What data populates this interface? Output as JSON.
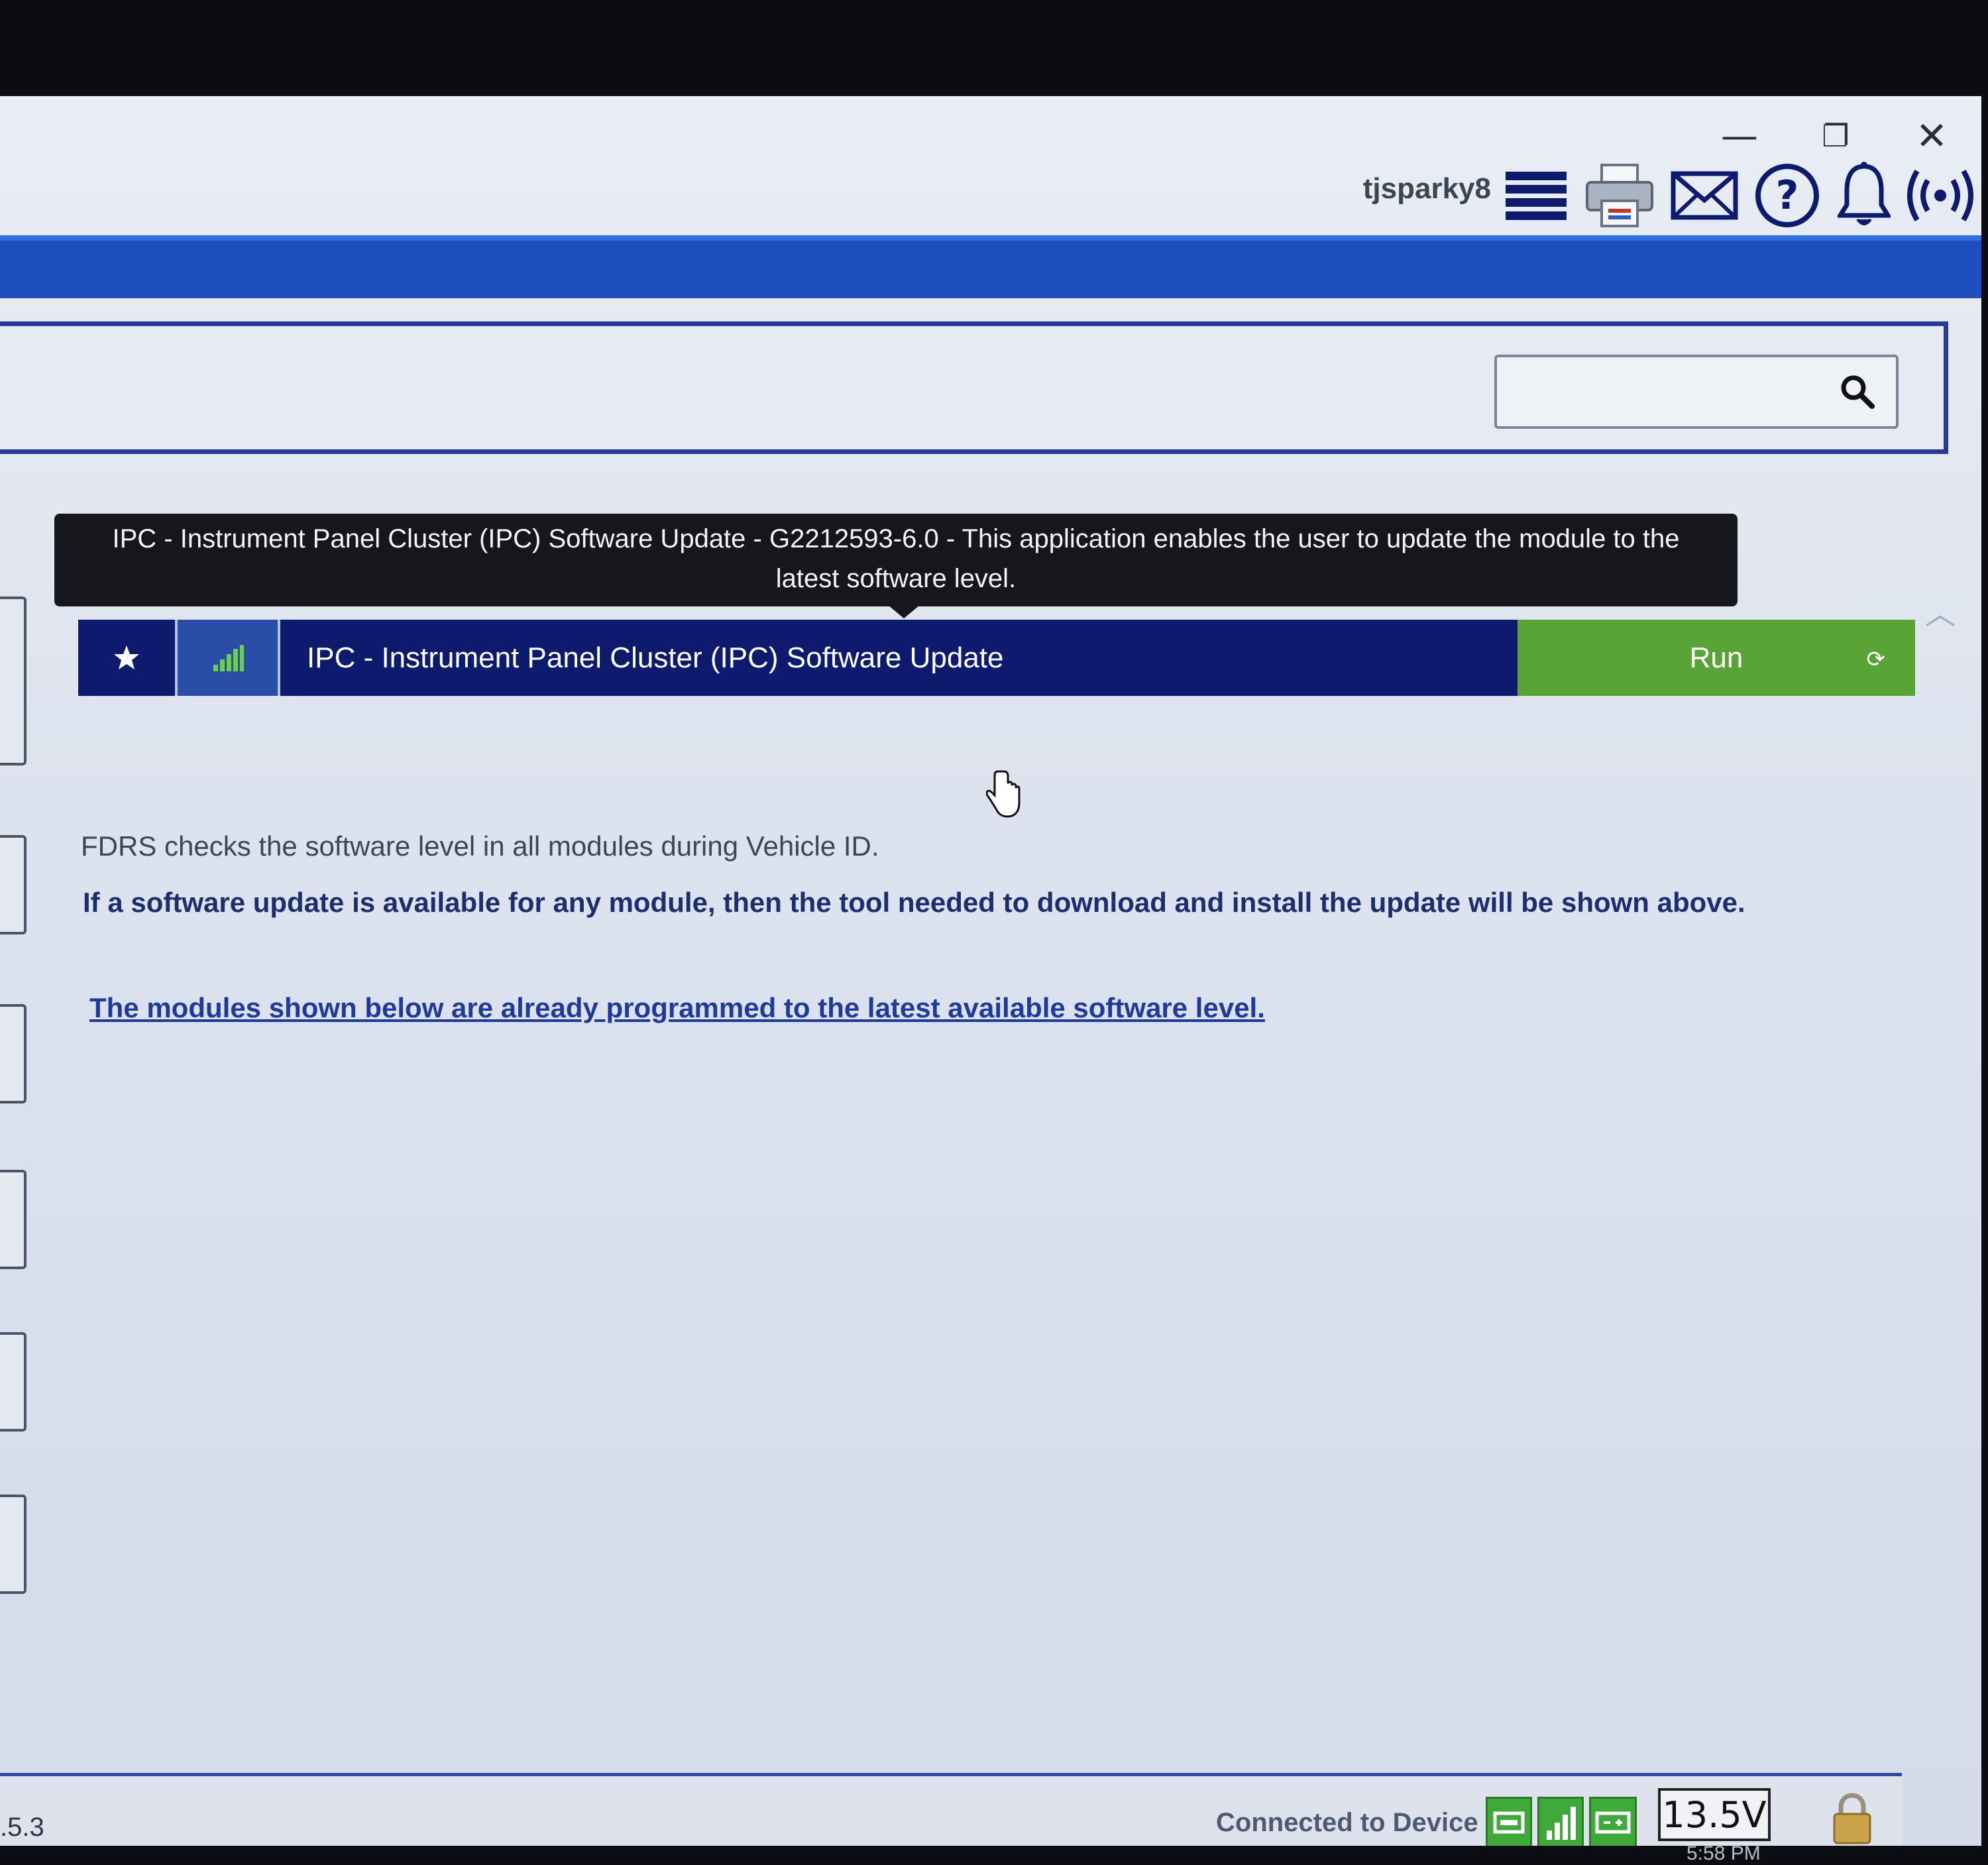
{
  "header": {
    "username": "tjsparky8",
    "icons": [
      "menu-icon",
      "printer-icon",
      "mail-icon",
      "help-icon",
      "bell-icon",
      "wireless-icon"
    ]
  },
  "window_controls": {
    "minimize": "—",
    "restore": "❐",
    "close": "✕"
  },
  "search": {
    "value": "",
    "placeholder": ""
  },
  "tooltip": {
    "text": "IPC - Instrument Panel Cluster (IPC) Software Update - G2212593-6.0 - This application enables the user to update the module to the latest software level."
  },
  "app_row": {
    "name": "IPC - Instrument Panel Cluster (IPC) Software Update",
    "run_label": "Run",
    "refresh_glyph": "⟳"
  },
  "content": {
    "line1": "FDRS checks the software level in all modules during Vehicle ID.",
    "line2": "If a software update is available for any module, then the tool needed to download and install the update will be shown above.",
    "line3": "The modules shown below are already programmed to the latest available software level."
  },
  "statusbar": {
    "version": ".5.3",
    "connection": "Connected to Device",
    "voltage": "13.5V",
    "time": "5:58 PM"
  },
  "colors": {
    "accent_blue": "#1f4fbf",
    "navy": "#0c1b6e",
    "run_green": "#5aa336",
    "status_green": "#3fa93a"
  }
}
